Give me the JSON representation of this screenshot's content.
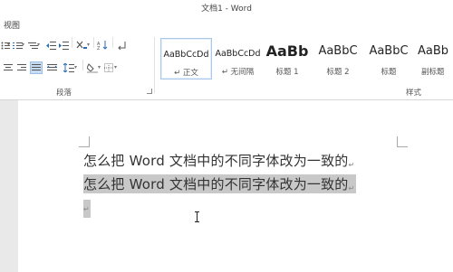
{
  "window": {
    "title": "文档1 - Word"
  },
  "menu": {
    "tab_view": "视图"
  },
  "ribbon": {
    "paragraph_group_label": "段落",
    "styles_group_label": "样式",
    "styles": [
      {
        "sample": "AaBbCcDd",
        "name": "↵ 正文",
        "selected": true
      },
      {
        "sample": "AaBbCcDd",
        "name": "↵ 无间隔",
        "selected": false
      },
      {
        "sample": "AaBb",
        "name": "标题 1",
        "selected": false
      },
      {
        "sample": "AaBbC",
        "name": "标题 2",
        "selected": false
      },
      {
        "sample": "AaBbC",
        "name": "标题",
        "selected": false
      },
      {
        "sample": "AaBb",
        "name": "副标题",
        "selected": false
      }
    ]
  },
  "document": {
    "paragraph_1": "怎么把 Word 文档中的不同字体改为一致的",
    "paragraph_2": "怎么把 Word 文档中的不同字体改为一致的",
    "paragraph_mark": "↵"
  },
  "colors": {
    "selection": "#c8c8c8",
    "gallery_selected_border": "#a9c8ea"
  }
}
